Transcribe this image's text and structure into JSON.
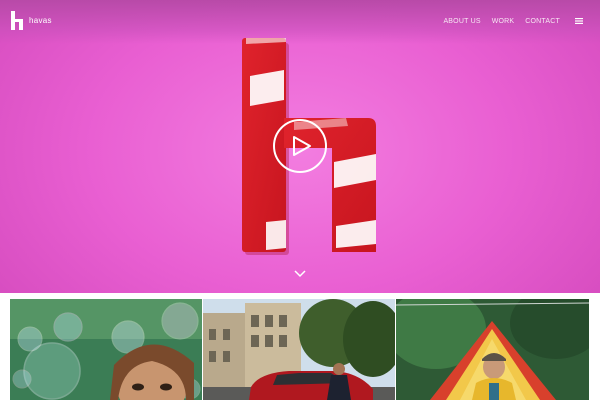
{
  "brand": {
    "name": "havas"
  },
  "nav": {
    "items": [
      {
        "label": "ABOUT US"
      },
      {
        "label": "WORK"
      },
      {
        "label": "CONTACT"
      }
    ]
  },
  "icons": {
    "logo": "havas-h-logo-icon",
    "menu": "menu-icon",
    "play": "play-icon",
    "scroll": "chevron-down-icon"
  },
  "colors": {
    "hero_background": "#e95fd2",
    "h_red": "#d8202a",
    "text_light": "#ffffff"
  },
  "tiles": [
    {
      "subject": "child-with-soap-bubbles"
    },
    {
      "subject": "woman-beside-red-car-on-street"
    },
    {
      "subject": "man-in-yellow-tent"
    }
  ]
}
